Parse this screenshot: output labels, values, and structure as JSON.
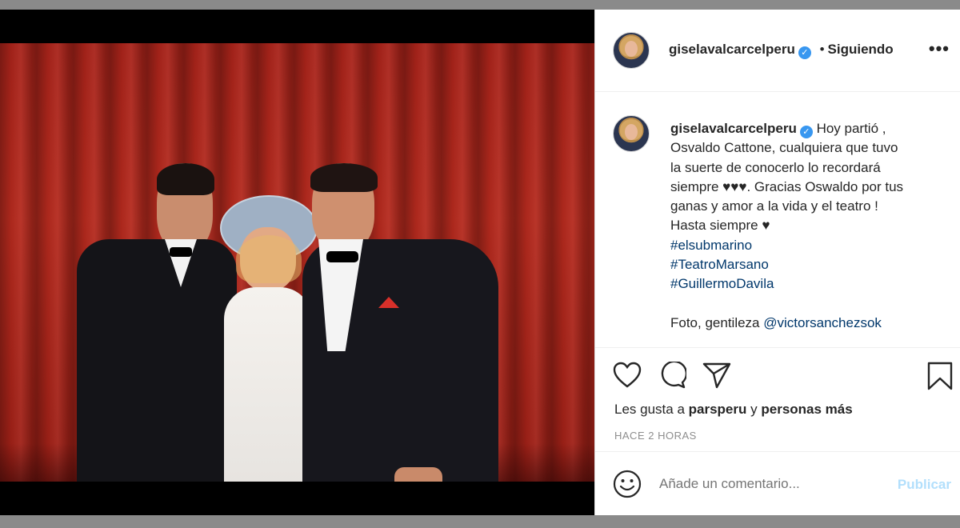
{
  "post": {
    "username": "giselavalcarcelperu",
    "verified_icon": "verified-badge-icon",
    "separator": "•",
    "follow_status": "Siguiendo",
    "more_label": "•••"
  },
  "caption": {
    "username": "giselavalcarcelperu",
    "line1": "Hoy partió ,",
    "line2": "Osvaldo Cattone, cualquiera que tuvo",
    "line3": "la suerte de conocerlo lo recordará",
    "line4": "siempre ♥♥♥. Gracias Oswaldo por tus",
    "line5": "ganas y amor a la vida y el teatro !",
    "line6": "Hasta siempre ♥",
    "hashtags": [
      "#elsubmarino",
      "#TeatroMarsano",
      "#GuillermoDavila"
    ],
    "credit_prefix": "Foto, gentileza",
    "credit_mention": "@victorsanchezsok"
  },
  "actions": {
    "like_icon": "heart-icon",
    "comment_icon": "comment-icon",
    "share_icon": "send-icon",
    "save_icon": "bookmark-icon"
  },
  "likes": {
    "prefix": "Les gusta a",
    "user": "parsperu",
    "connector": "y",
    "others": "personas más"
  },
  "timestamp": "HACE 2 HORAS",
  "comment": {
    "emoji_icon": "emoji-icon",
    "placeholder": "Añade un comentario...",
    "publish_label": "Publicar"
  },
  "colors": {
    "link": "#00376b",
    "publish_disabled": "#b2dffc",
    "verified": "#3897f0",
    "curtain": "#a8231a"
  }
}
